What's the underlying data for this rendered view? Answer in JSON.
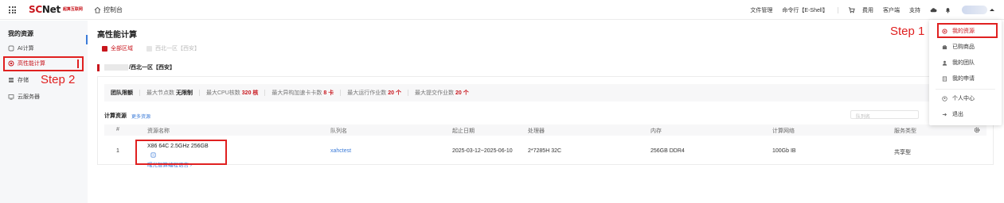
{
  "header": {
    "logo_main": "SC",
    "logo_net": "Net",
    "logo_sub": "超算互联网",
    "console_label": "控制台",
    "nav": [
      "文件管理",
      "命令行【E-Shell】"
    ],
    "nav2": [
      "费用",
      "客户端",
      "支持"
    ]
  },
  "sidebar": {
    "title": "我的资源",
    "items": [
      {
        "label": "AI计算",
        "icon": "ai-icon"
      },
      {
        "label": "高性能计算",
        "icon": "hpc-icon"
      },
      {
        "label": "存储",
        "icon": "storage-icon"
      },
      {
        "label": "云服务器",
        "icon": "server-icon"
      }
    ]
  },
  "annotations": {
    "step1": "Step 1",
    "step2": "Step 2"
  },
  "main": {
    "title": "高性能计算",
    "filters": [
      {
        "label": "全部区域",
        "checked": true
      },
      {
        "label": "西北一区【西安】",
        "checked": false
      }
    ],
    "region_label": "/西北一区【西安】",
    "quota": {
      "title": "团队限额",
      "items": [
        {
          "label": "最大节点数",
          "value": "无限制",
          "red": false
        },
        {
          "label": "最大CPU核数",
          "value": "320 核",
          "red": true
        },
        {
          "label": "最大异构加速卡卡数",
          "value": "8 卡",
          "red": true
        },
        {
          "label": "最大运行作业数",
          "value": "20 个",
          "red": true
        },
        {
          "label": "最大提交作业数",
          "value": "20 个",
          "red": true
        }
      ]
    },
    "resources": {
      "title": "计算资源",
      "more": "更多资源",
      "queue_placeholder": "队列名",
      "columns": [
        "#",
        "资源名称",
        "队列名",
        "起止日期",
        "处理器",
        "内存",
        "计算网络",
        "服务类型"
      ],
      "rows": [
        {
          "index": "1",
          "name": "X86 64C 2.5GHz 256GB",
          "sub": "曙光智算编程语言 ›",
          "queue": "xahctest",
          "dates": "2025-03-12~2025-06-10",
          "cpu": "2*7285H 32C",
          "memory": "256GB DDR4",
          "network": "100Gb IB",
          "service": "共享型"
        }
      ]
    }
  },
  "dropdown": {
    "items": [
      {
        "label": "我的资源",
        "icon": "resource-icon",
        "active": true
      },
      {
        "label": "已购商品",
        "icon": "bag-icon",
        "active": false
      },
      {
        "label": "我的团队",
        "icon": "team-icon",
        "active": false
      },
      {
        "label": "我的申请",
        "icon": "apply-icon",
        "active": false
      },
      {
        "label": "个人中心",
        "icon": "user-icon",
        "active": false
      },
      {
        "label": "退出",
        "icon": "logout-icon",
        "active": false
      }
    ]
  },
  "colors": {
    "brand": "#c8161d",
    "link": "#3b7bd8",
    "annotation": "#e02020"
  }
}
